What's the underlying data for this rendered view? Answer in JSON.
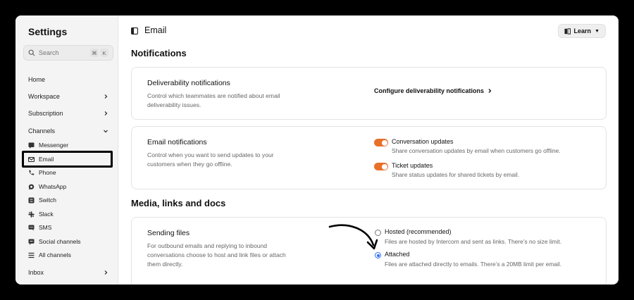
{
  "sidebar": {
    "title": "Settings",
    "search": {
      "placeholder": "Search",
      "shortcut": [
        "⌘",
        "K"
      ]
    },
    "nav": [
      {
        "label": "Home"
      },
      {
        "label": "Workspace"
      },
      {
        "label": "Subscription"
      },
      {
        "label": "Channels"
      }
    ],
    "channels": [
      {
        "label": "Messenger",
        "icon": "messenger-icon"
      },
      {
        "label": "Email",
        "icon": "mail-icon",
        "selected": true
      },
      {
        "label": "Phone",
        "icon": "phone-icon"
      },
      {
        "label": "WhatsApp",
        "icon": "whatsapp-icon"
      },
      {
        "label": "Switch",
        "icon": "switch-icon"
      },
      {
        "label": "Slack",
        "icon": "slack-icon"
      },
      {
        "label": "SMS",
        "icon": "sms-icon"
      },
      {
        "label": "Social channels",
        "icon": "social-icon"
      },
      {
        "label": "All channels",
        "icon": "list-icon"
      }
    ],
    "inbox": {
      "label": "Inbox"
    }
  },
  "header": {
    "title": "Email",
    "learn_label": "Learn"
  },
  "notifications": {
    "section_title": "Notifications",
    "deliverability": {
      "title": "Deliverability notifications",
      "description": "Control which teammates are notified about email deliverability issues.",
      "link": "Configure deliverability notifications"
    },
    "email": {
      "title": "Email notifications",
      "description": "Control when you want to send updates to your customers when they go offline.",
      "options": [
        {
          "label": "Conversation updates",
          "description": "Share conversation updates by email when customers go offline.",
          "enabled": true
        },
        {
          "label": "Ticket updates",
          "description": "Share status updates for shared tickets by email.",
          "enabled": true
        }
      ]
    }
  },
  "media": {
    "section_title": "Media, links and docs",
    "sending_files": {
      "title": "Sending files",
      "description": "For outbound emails and replying to inbound conversations choose to host and link files or attach them directly.",
      "options": [
        {
          "label": "Hosted (recommended)",
          "description": "Files are hosted by Intercom and sent as links. There’s no size limit.",
          "selected": false
        },
        {
          "label": "Attached",
          "description": "Files are attached directly to emails. There’s a 20MB limit per email.",
          "selected": true
        }
      ]
    }
  },
  "colors": {
    "accent_orange": "#e8702a",
    "radio_blue": "#2a6ef5",
    "highlight_border": "#000000"
  }
}
